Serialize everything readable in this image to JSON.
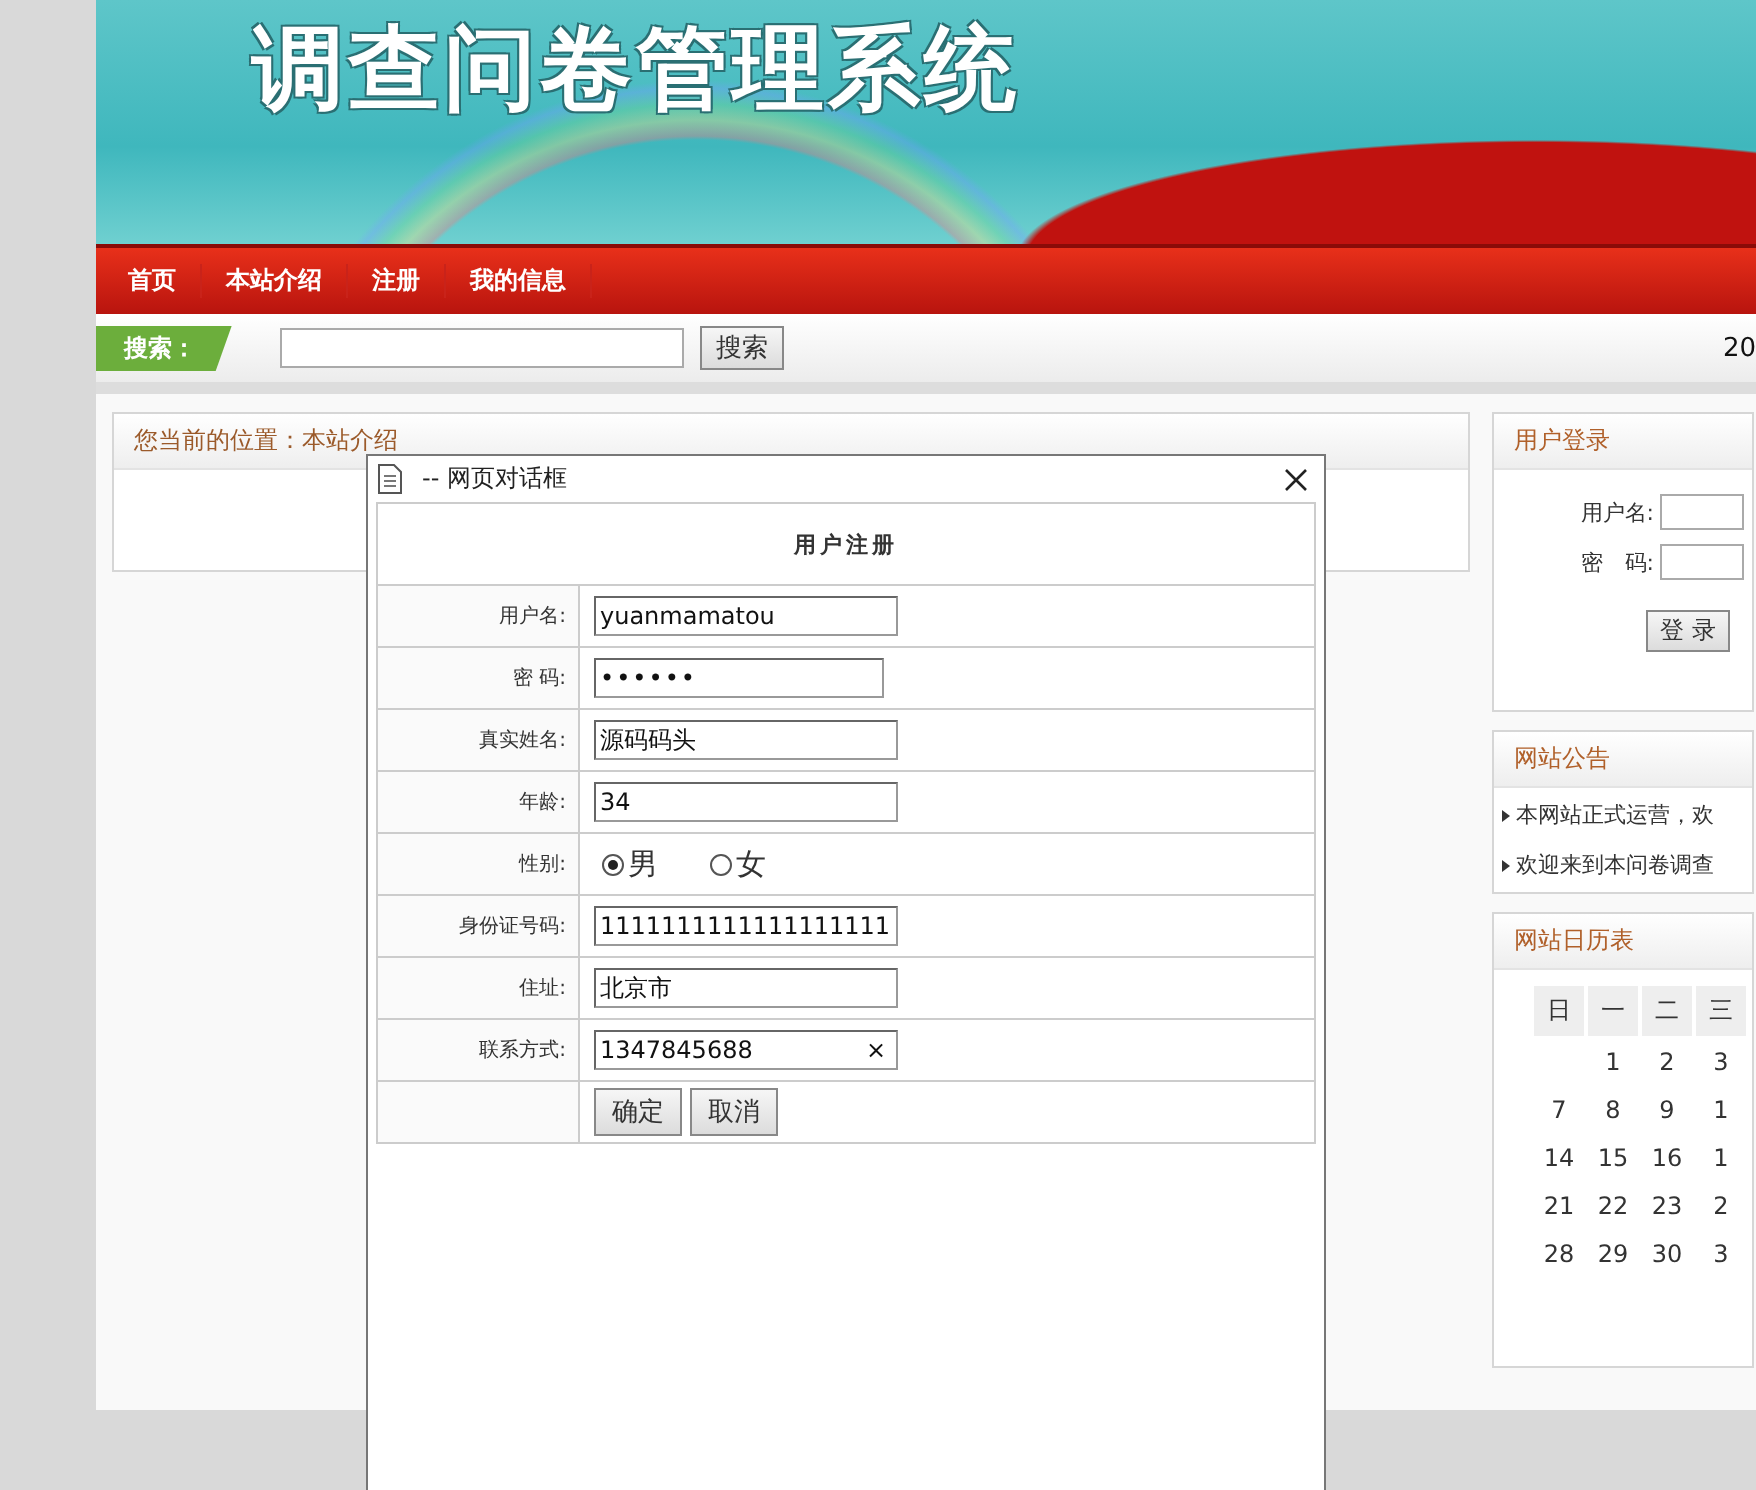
{
  "banner": {
    "title": "调查问卷管理系统"
  },
  "nav": {
    "items": [
      "首页",
      "本站介绍",
      "注册",
      "我的信息"
    ]
  },
  "search": {
    "label": "搜索：",
    "button": "搜索",
    "date": "20"
  },
  "breadcrumb": "您当前的位置：本站介绍",
  "dialog": {
    "title": "-- 网页对话框",
    "heading": "用户注册",
    "rows": [
      {
        "kind": "text",
        "label": "用户名:",
        "value": "yuanmamatou"
      },
      {
        "kind": "password",
        "label": "密 码:",
        "value": "••••••"
      },
      {
        "kind": "text",
        "label": "真实姓名:",
        "value": "源码码头"
      },
      {
        "kind": "text",
        "label": "年龄:",
        "value": "34"
      },
      {
        "kind": "radio",
        "label": "性别:",
        "options": [
          {
            "label": "男",
            "selected": true
          },
          {
            "label": "女",
            "selected": false
          }
        ]
      },
      {
        "kind": "text",
        "label": "身份证号码:",
        "value": "1111111111111111111"
      },
      {
        "kind": "text",
        "label": "住址:",
        "value": "北京市"
      },
      {
        "kind": "clearable",
        "label": "联系方式:",
        "value": "1347845688",
        "clear": "×"
      },
      {
        "kind": "buttons",
        "buttons": [
          "确定",
          "取消"
        ]
      }
    ]
  },
  "login": {
    "title": "用户登录",
    "fields": [
      "用户名:",
      "密　码:"
    ],
    "button": "登 录"
  },
  "notice": {
    "title": "网站公告",
    "items": [
      "本网站正式运营，欢",
      "欢迎来到本问卷调查"
    ]
  },
  "calendar": {
    "title": "网站日历表",
    "headers": [
      "日",
      "一",
      "二",
      "三"
    ],
    "rows": [
      [
        "",
        "1",
        "2",
        "3"
      ],
      [
        "7",
        "8",
        "9",
        "1"
      ],
      [
        "14",
        "15",
        "16",
        "1"
      ],
      [
        "21",
        "22",
        "23",
        "2"
      ],
      [
        "28",
        "29",
        "30",
        "3"
      ]
    ]
  }
}
